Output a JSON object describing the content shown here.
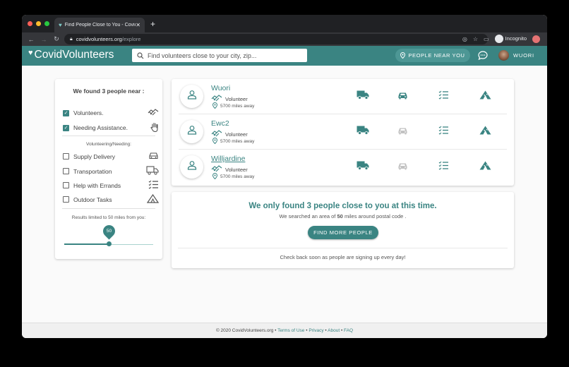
{
  "browser": {
    "tab_title": "Find People Close to You - CovidVolunteers",
    "url_domain": "covidvolunteers.org",
    "url_path": "/explore",
    "incognito_label": "Incognito"
  },
  "header": {
    "logo_text": "CovidVolunteers",
    "search_placeholder": "Find volunteers close to your city, zip...",
    "people_near_label": "PEOPLE NEAR YOU",
    "user_name": "WUORI"
  },
  "filter": {
    "title": "We found 3 people near :",
    "roles": [
      {
        "label": "Volunteers.",
        "checked": true,
        "icon": "handshake-icon"
      },
      {
        "label": "Needing Assistance.",
        "checked": true,
        "icon": "raised-hand-icon"
      }
    ],
    "subheading": "Volunteering/Needing:",
    "needs": [
      {
        "label": "Supply Delivery",
        "checked": false,
        "icon": "car-icon"
      },
      {
        "label": "Transportation",
        "checked": false,
        "icon": "truck-icon"
      },
      {
        "label": "Help with Errands",
        "checked": false,
        "icon": "checklist-icon"
      },
      {
        "label": "Outdoor Tasks",
        "checked": false,
        "icon": "tent-icon"
      }
    ],
    "radius_label": "Results limited to 50 miles from you:",
    "radius_value": "50",
    "radius_fraction": 0.5
  },
  "people": [
    {
      "name": "Wuori",
      "role": "Volunteer",
      "distance": "5700 miles away",
      "active": [
        true,
        true,
        true,
        true
      ],
      "underline": false
    },
    {
      "name": "Ewc2",
      "role": "Volunteer",
      "distance": "5700 miles away",
      "active": [
        true,
        false,
        true,
        true
      ],
      "underline": false
    },
    {
      "name": "Willjardine",
      "role": "Volunteer",
      "distance": "5700 miles away",
      "active": [
        true,
        false,
        true,
        true
      ],
      "underline": true
    }
  ],
  "notice": {
    "headline": "We only found 3 people close to you at this time.",
    "sub_prefix": "We searched an area of",
    "sub_bold": "50",
    "sub_suffix": "miles around postal code .",
    "button": "FIND MORE PEOPLE",
    "footnote": "Check back soon as people are signing up every day!"
  },
  "footer": {
    "copyright": "© 2020 CovidVolunteers.org •",
    "links": [
      "Terms of Use",
      "Privacy",
      "About",
      "FAQ"
    ]
  },
  "colors": {
    "accent": "#3a8482",
    "icon_inactive": "#c2c2c2"
  }
}
